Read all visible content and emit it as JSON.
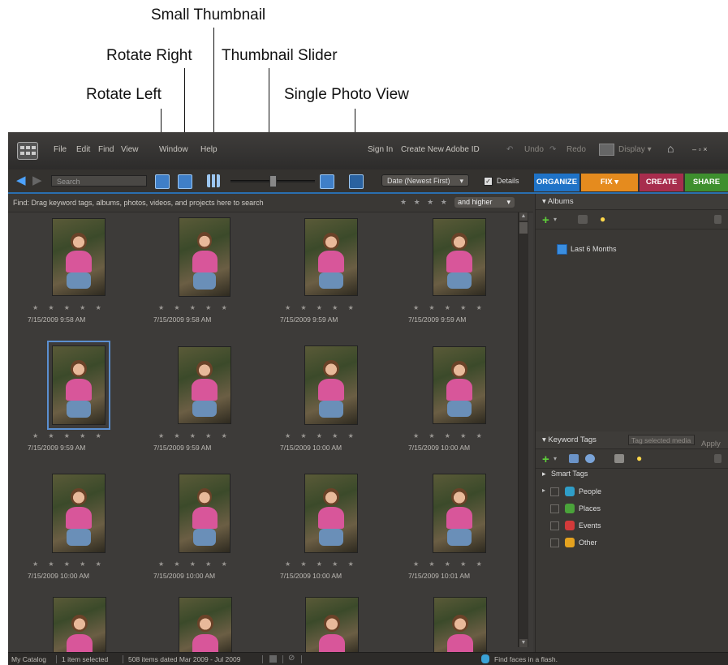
{
  "callouts": {
    "small_thumbnail": "Small Thumbnail",
    "rotate_right": "Rotate Right",
    "thumbnail_slider": "Thumbnail Slider",
    "rotate_left": "Rotate Left",
    "single_photo_view": "Single Photo View"
  },
  "menu": {
    "items": [
      "File",
      "Edit",
      "Find",
      "View",
      "Window",
      "Help"
    ],
    "sign_in": "Sign In",
    "create_id": "Create New Adobe ID",
    "undo": "Undo",
    "redo": "Redo",
    "display": "Display"
  },
  "toolbar": {
    "search_placeholder": "Search",
    "sort": "Date (Newest First)",
    "details_label": "Details",
    "details_checked": true
  },
  "tabs": {
    "organize": "ORGANIZE",
    "fix": "FIX",
    "create": "CREATE",
    "share": "SHARE"
  },
  "find_bar": {
    "text": "Find: Drag keyword tags, albums, photos, videos, and projects here to search",
    "stars": "★ ★ ★ ★ ★",
    "rating_filter": "and higher"
  },
  "thumbnails": [
    {
      "stars": "★ ★ ★ ★ ★",
      "date": "7/15/2009 9:58 AM"
    },
    {
      "stars": "★ ★ ★ ★ ★",
      "date": "7/15/2009 9:58 AM"
    },
    {
      "stars": "★ ★ ★ ★ ★",
      "date": "7/15/2009 9:59 AM"
    },
    {
      "stars": "★ ★ ★ ★ ★",
      "date": "7/15/2009 9:59 AM"
    },
    {
      "stars": "★ ★ ★ ★ ★",
      "date": "7/15/2009 9:59 AM"
    },
    {
      "stars": "★ ★ ★ ★ ★",
      "date": "7/15/2009 9:59 AM"
    },
    {
      "stars": "★ ★ ★ ★ ★",
      "date": "7/15/2009 10:00 AM"
    },
    {
      "stars": "★ ★ ★ ★ ★",
      "date": "7/15/2009 10:00 AM"
    },
    {
      "stars": "★ ★ ★ ★ ★",
      "date": "7/15/2009 10:00 AM"
    },
    {
      "stars": "★ ★ ★ ★ ★",
      "date": "7/15/2009 10:00 AM"
    },
    {
      "stars": "★ ★ ★ ★ ★",
      "date": "7/15/2009 10:00 AM"
    },
    {
      "stars": "★ ★ ★ ★ ★",
      "date": "7/15/2009 10:01 AM"
    }
  ],
  "albums": {
    "header": "Albums",
    "items": [
      "Last 6 Months"
    ]
  },
  "keyword_tags": {
    "header": "Keyword Tags",
    "field_placeholder": "Tag selected media",
    "apply": "Apply",
    "smart_tags": "Smart Tags",
    "items": [
      "People",
      "Places",
      "Events",
      "Other"
    ]
  },
  "status": {
    "catalog": "My Catalog",
    "selected": "1 item selected",
    "range": "508 items dated Mar 2009 - Jul 2009",
    "tip": "Find faces in a flash."
  }
}
